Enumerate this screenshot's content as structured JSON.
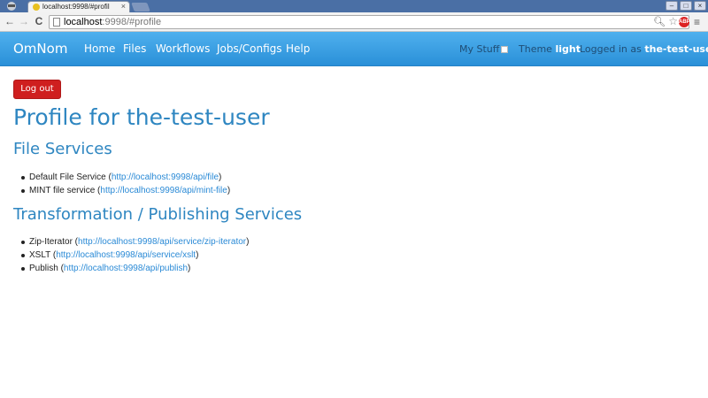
{
  "browser": {
    "tab_title": "localhost:9998/#profil",
    "tab_close": "×",
    "url_host": "localhost",
    "url_rest": ":9998/#profile",
    "nav_back": "←",
    "nav_forward": "→",
    "nav_reload": "C",
    "window_buttons": [
      "–",
      "□",
      "×"
    ]
  },
  "navbar": {
    "brand": "OmNom",
    "links": [
      "Home",
      "Files",
      "Workflows",
      "Jobs/Configs",
      "Help"
    ],
    "my_stuff_label": "My Stuff",
    "theme_label": "Theme",
    "theme_value": "light",
    "logged_in_label": "Logged in as",
    "username": "the-test-user"
  },
  "main": {
    "logout_button": "Log out",
    "page_title": "Profile for the-test-user",
    "sections": [
      {
        "heading": "File Services",
        "items": [
          {
            "name": "Default File Service",
            "url": "http://localhost:9998/api/file"
          },
          {
            "name": "MINT file service",
            "url": "http://localhost:9998/api/mint-file"
          }
        ]
      },
      {
        "heading": "Transformation / Publishing Services",
        "items": [
          {
            "name": "Zip-Iterator",
            "url": "http://localhost:9998/api/service/zip-iterator"
          },
          {
            "name": "XSLT",
            "url": "http://localhost:9998/api/service/xslt"
          },
          {
            "name": "Publish",
            "url": "http://localhost:9998/api/publish"
          }
        ]
      }
    ]
  },
  "colors": {
    "navbar_top": "#4fb0ee",
    "navbar_bottom": "#2a90d8",
    "heading": "#2e86c1",
    "link": "#2a8ad6",
    "logout_bg": "#cf1f1f"
  }
}
